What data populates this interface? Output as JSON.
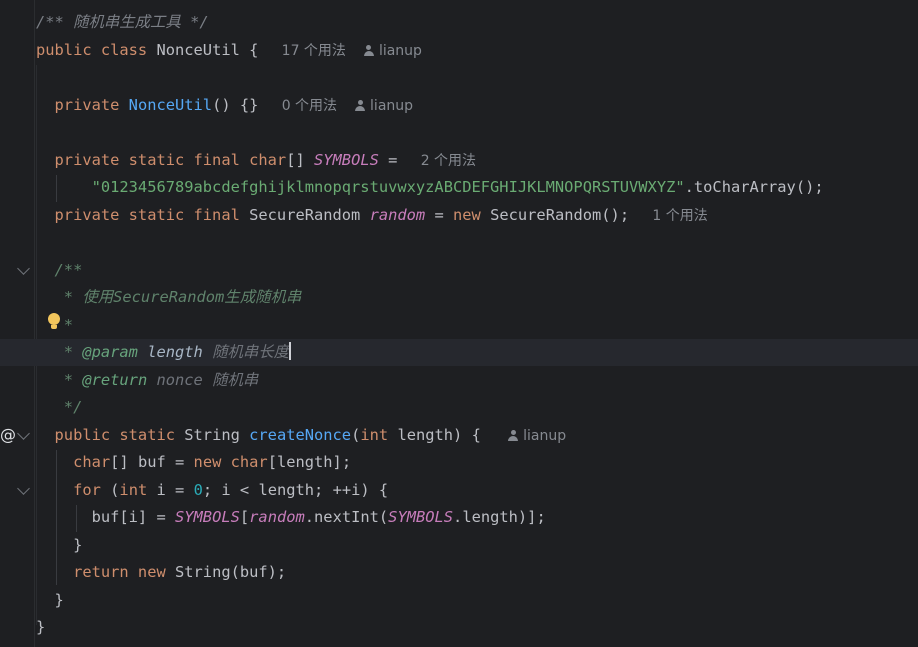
{
  "editor": {
    "lines": [
      {
        "id": "l1",
        "parts": [
          {
            "t": "/** ",
            "c": "com"
          },
          {
            "t": "随机串生成工具",
            "c": "com"
          },
          {
            "t": " */",
            "c": "com"
          }
        ]
      },
      {
        "id": "l2",
        "parts": [
          {
            "t": "public class ",
            "c": "kw"
          },
          {
            "t": "NonceUtil { ",
            "c": "cls"
          }
        ],
        "hint": "17 个用法",
        "author": "lianup"
      },
      {
        "id": "l3",
        "parts": []
      },
      {
        "id": "l4",
        "parts": [
          {
            "t": "  private ",
            "c": "kw"
          },
          {
            "t": "NonceUtil",
            "c": "fn"
          },
          {
            "t": "() {} ",
            "c": "cls"
          }
        ],
        "hint": "0 个用法",
        "author": "lianup"
      },
      {
        "id": "l5",
        "parts": []
      },
      {
        "id": "l6",
        "parts": [
          {
            "t": "  private static final char",
            "c": "kw"
          },
          {
            "t": "[] ",
            "c": "cls"
          },
          {
            "t": "SYMBOLS",
            "c": "const"
          },
          {
            "t": " = ",
            "c": "cls"
          }
        ],
        "hint": "2 个用法"
      },
      {
        "id": "l7",
        "parts": [
          {
            "t": "      \"0123456789abcdefghijklmnopqrstuvwxyzABCDEFGHIJKLMNOPQRSTUVWXYZ\"",
            "c": "str"
          },
          {
            "t": ".toCharArray();",
            "c": "cls"
          }
        ]
      },
      {
        "id": "l8",
        "parts": [
          {
            "t": "  private static final ",
            "c": "kw"
          },
          {
            "t": "SecureRandom ",
            "c": "cls"
          },
          {
            "t": "random",
            "c": "field"
          },
          {
            "t": " = ",
            "c": "cls"
          },
          {
            "t": "new ",
            "c": "kw"
          },
          {
            "t": "SecureRandom(); ",
            "c": "cls"
          }
        ],
        "hint": "1 个用法"
      },
      {
        "id": "l9",
        "parts": []
      },
      {
        "id": "l10",
        "parts": [
          {
            "t": "  /**",
            "c": "doc"
          }
        ]
      },
      {
        "id": "l11",
        "parts": [
          {
            "t": "   * 使用SecureRandom生成随机串",
            "c": "doc"
          }
        ]
      },
      {
        "id": "l12",
        "parts": [
          {
            "t": "   *",
            "c": "doc"
          }
        ]
      },
      {
        "id": "l13",
        "parts": [
          {
            "t": "   * ",
            "c": "doc"
          },
          {
            "t": "@param",
            "c": "doctag"
          },
          {
            "t": " length ",
            "c": "docparam"
          },
          {
            "t": "随机串长度",
            "c": "docsec"
          }
        ],
        "caret": true
      },
      {
        "id": "l14",
        "parts": [
          {
            "t": "   * ",
            "c": "doc"
          },
          {
            "t": "@return",
            "c": "doctag"
          },
          {
            "t": " nonce 随机串",
            "c": "docsec"
          }
        ]
      },
      {
        "id": "l15",
        "parts": [
          {
            "t": "   */",
            "c": "doc"
          }
        ]
      },
      {
        "id": "l16",
        "parts": [
          {
            "t": "  public static ",
            "c": "kw"
          },
          {
            "t": "String ",
            "c": "cls"
          },
          {
            "t": "createNonce",
            "c": "fn"
          },
          {
            "t": "(",
            "c": "cls"
          },
          {
            "t": "int ",
            "c": "kw"
          },
          {
            "t": "length) { ",
            "c": "cls"
          }
        ],
        "author": "lianup"
      },
      {
        "id": "l17",
        "parts": [
          {
            "t": "    char",
            "c": "kw"
          },
          {
            "t": "[] buf = ",
            "c": "cls"
          },
          {
            "t": "new char",
            "c": "kw"
          },
          {
            "t": "[length];",
            "c": "cls"
          }
        ]
      },
      {
        "id": "l18",
        "parts": [
          {
            "t": "    for ",
            "c": "kw"
          },
          {
            "t": "(",
            "c": "cls"
          },
          {
            "t": "int ",
            "c": "kw"
          },
          {
            "t": "i = ",
            "c": "cls"
          },
          {
            "t": "0",
            "c": "num"
          },
          {
            "t": "; i < length; ++i) {",
            "c": "cls"
          }
        ]
      },
      {
        "id": "l19",
        "parts": [
          {
            "t": "      buf[i] = ",
            "c": "cls"
          },
          {
            "t": "SYMBOLS",
            "c": "const"
          },
          {
            "t": "[",
            "c": "cls"
          },
          {
            "t": "random",
            "c": "field"
          },
          {
            "t": ".nextInt(",
            "c": "cls"
          },
          {
            "t": "SYMBOLS",
            "c": "const"
          },
          {
            "t": ".length)];",
            "c": "cls"
          }
        ]
      },
      {
        "id": "l20",
        "parts": [
          {
            "t": "    }",
            "c": "cls"
          }
        ]
      },
      {
        "id": "l21",
        "parts": [
          {
            "t": "    return new ",
            "c": "kw"
          },
          {
            "t": "String(buf);",
            "c": "cls"
          }
        ]
      },
      {
        "id": "l22",
        "parts": [
          {
            "t": "  }",
            "c": "cls"
          }
        ]
      },
      {
        "id": "l23",
        "parts": [
          {
            "t": "}",
            "c": "cls"
          }
        ]
      }
    ],
    "gutter_at": "@",
    "current_line_index": 12
  }
}
